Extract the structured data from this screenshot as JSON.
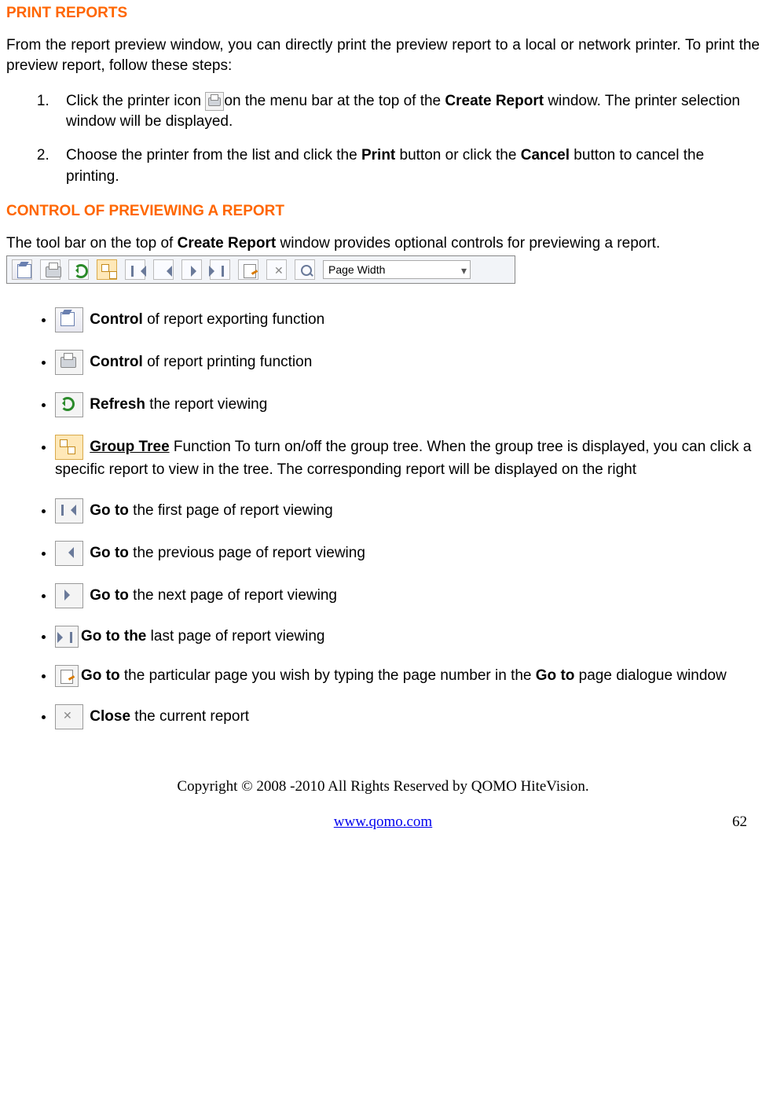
{
  "h1": "PRINT REPORTS",
  "intro": "From the report preview window, you can directly print the preview report to a local or network printer. To print the preview report, follow these steps:",
  "steps": {
    "num1": "1.",
    "s1a": "Click the printer icon ",
    "s1b": "on the menu bar at the top of the ",
    "s1_bold": "Create Report",
    "s1c": " window. The printer selection window will be displayed.",
    "num2": "2.",
    "s2a": "Choose the printer from the list and click the ",
    "s2_bold1": "Print",
    "s2b": " button or click the ",
    "s2_bold2": "Cancel",
    "s2c": " button to cancel the printing."
  },
  "h2": "CONTROL OF PREVIEWING A REPORT",
  "para2a": "The tool bar on the top of ",
  "para2bold": "Create Report",
  "para2b": " window provides optional controls for previewing a report.",
  "toolbar_select": "Page Width",
  "bullets": {
    "b1_bold": "Control",
    "b1_txt": " of report exporting function",
    "b2_bold": "Control",
    "b2_txt": " of report printing function",
    "b3_bold": "Refresh",
    "b3_txt": " the report viewing",
    "b4_bold": "Group Tree",
    "b4_txt": " Function To turn on/off the group tree. When the group tree is displayed, you can click a specific report to view in the tree. The corresponding report will be displayed on the right",
    "b5_bold": "Go to",
    "b5_txt": " the first page of report viewing",
    "b6_bold": "Go to",
    "b6_txt": " the previous page of report viewing",
    "b7_bold": "Go to",
    "b7_txt": " the next page of report viewing",
    "b8_bold": "Go to the",
    "b8_txt": " last page of report viewing",
    "b9_bold1": "Go to",
    "b9_txt1": " the particular page you wish by typing the page number in the ",
    "b9_bold2": "Go to",
    "b9_txt2": " page dialogue window",
    "b10_bold": "Close",
    "b10_txt": " the current report"
  },
  "footer": {
    "copyright": "Copyright © 2008 -2010 All Rights Reserved by QOMO HiteVision.",
    "url": "www.qomo.com",
    "page": "62"
  }
}
